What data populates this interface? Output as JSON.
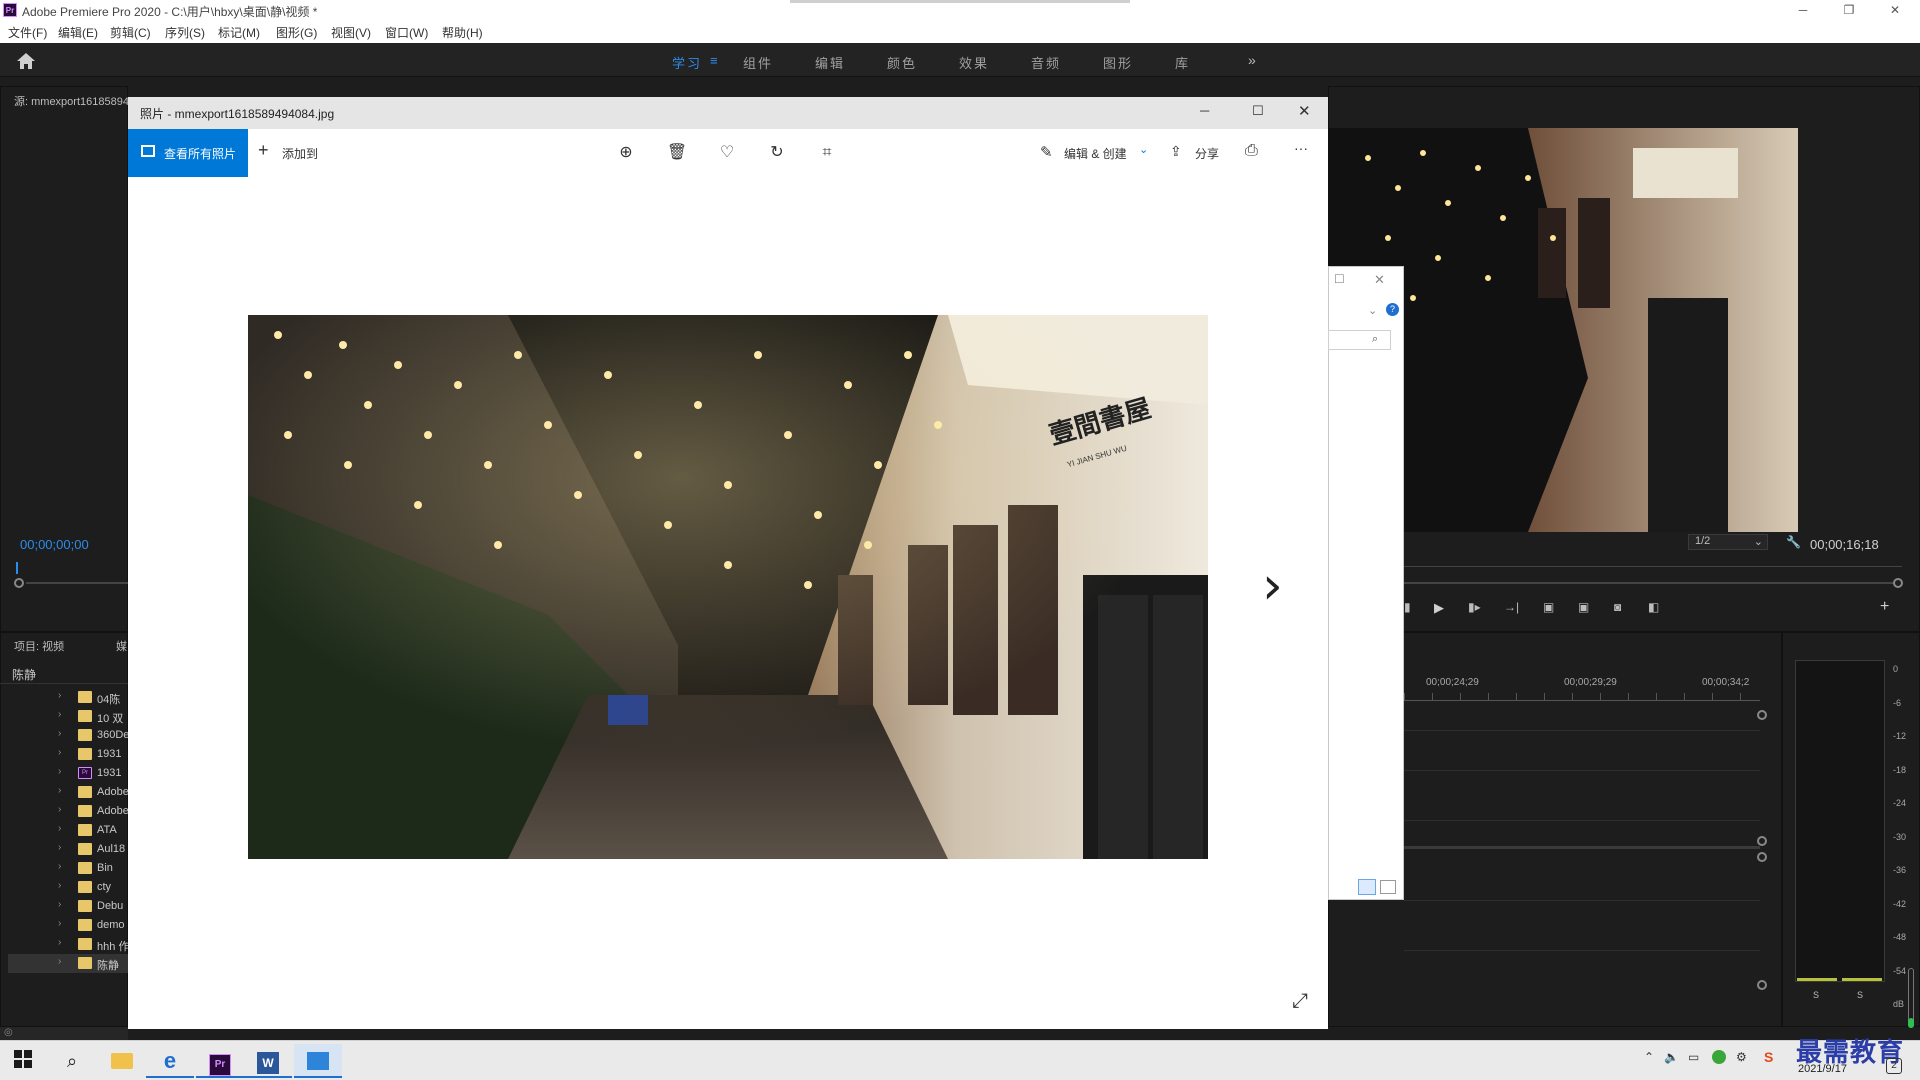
{
  "premiere": {
    "title": "Adobe Premiere Pro 2020 - C:\\用户\\hbxy\\桌面\\静\\视频 *",
    "logo": "Pr",
    "menu": [
      "文件(F)",
      "编辑(E)",
      "剪辑(C)",
      "序列(S)",
      "标记(M)",
      "图形(G)",
      "视图(V)",
      "窗口(W)",
      "帮助(H)"
    ],
    "workspaces": [
      "学习",
      "组件",
      "编辑",
      "颜色",
      "效果",
      "音频",
      "图形",
      "库"
    ],
    "workspace_active": "学习",
    "more": "»",
    "source_panel_title": "源: mmexport16185894",
    "source_timecode": "00;00;00;00",
    "program_timecode": "00;00;16;18",
    "program_zoom": "1/2",
    "project_panel_title": "项目: 视频",
    "project_tab2": "媒",
    "project_search": "陈静",
    "bins": [
      {
        "label": "04陈",
        "type": "folder"
      },
      {
        "label": "10 双",
        "type": "folder"
      },
      {
        "label": "360De",
        "type": "folder"
      },
      {
        "label": "1931",
        "type": "folder"
      },
      {
        "label": "1931",
        "type": "pr"
      },
      {
        "label": "Adobe",
        "type": "folder"
      },
      {
        "label": "Adobe",
        "type": "folder"
      },
      {
        "label": "ATA",
        "type": "folder"
      },
      {
        "label": "Aul18",
        "type": "folder"
      },
      {
        "label": "Bin",
        "type": "folder"
      },
      {
        "label": "cty",
        "type": "folder"
      },
      {
        "label": "Debu",
        "type": "folder"
      },
      {
        "label": "demo",
        "type": "folder"
      },
      {
        "label": "hhh 作",
        "type": "folder"
      },
      {
        "label": "陈静",
        "type": "folder"
      }
    ],
    "timeline_ruler": [
      "00;00;24;29",
      "00;00;29;29",
      "00;00;34;2"
    ],
    "meter_scale": [
      "0",
      "-6",
      "-12",
      "-18",
      "-24",
      "-30",
      "-36",
      "-42",
      "-48",
      "-54",
      "dB"
    ],
    "meter_solo": [
      "S",
      "S"
    ]
  },
  "photos": {
    "title": "照片 - mmexport1618589494084.jpg",
    "view_all": "查看所有照片",
    "add_to": "添加到",
    "edit_create": "编辑 & 创建",
    "share": "分享",
    "more": "···",
    "photo_sign": "壹間書屋",
    "photo_sign_sub": "YI JIAN SHU WU",
    "next": "›",
    "fullscreen": "⤢"
  },
  "taskbar": {
    "date": "2021/9/17",
    "watermark": "最需教育",
    "notif_count": "2"
  },
  "colors": {
    "accent": "#2d8ceb",
    "photos_accent": "#0078d7",
    "panel_bg": "#1d1d1d"
  }
}
